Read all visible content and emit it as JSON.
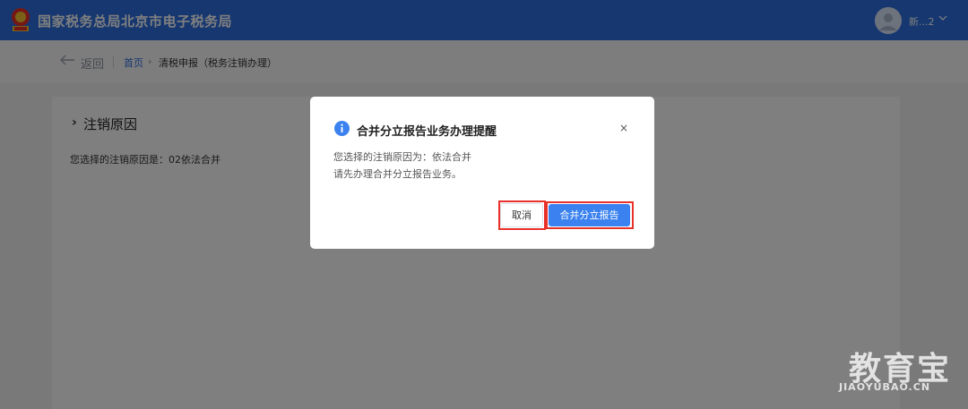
{
  "header": {
    "app_title": "国家税务总局北京市电子税务局",
    "username": "新...2",
    "brand_color": "#2d6fe0"
  },
  "breadcrumb": {
    "back_label": "返回",
    "home": "首页",
    "separator": "›",
    "current": "清税申报（税务注销办理）"
  },
  "main": {
    "section_marker": "›",
    "section_title": "注销原因",
    "reason_text": "您选择的注销原因是：02依法合并"
  },
  "modal": {
    "title": "合并分立报告业务办理提醒",
    "close": "×",
    "line1": "您选择的注销原因为：依法合并",
    "line2": "请先办理合并分立报告业务。",
    "cancel_label": "取消",
    "primary_label": "合并分立报告",
    "primary_color": "#3b82f0",
    "highlight_color": "#e8312a"
  },
  "watermark": {
    "brand": "教育宝",
    "url": "JIAOYUBAO.CN"
  },
  "icons": [
    "emblem-logo",
    "avatar",
    "chevron-down-icon",
    "back-arrow-icon",
    "info-icon",
    "close-icon"
  ]
}
